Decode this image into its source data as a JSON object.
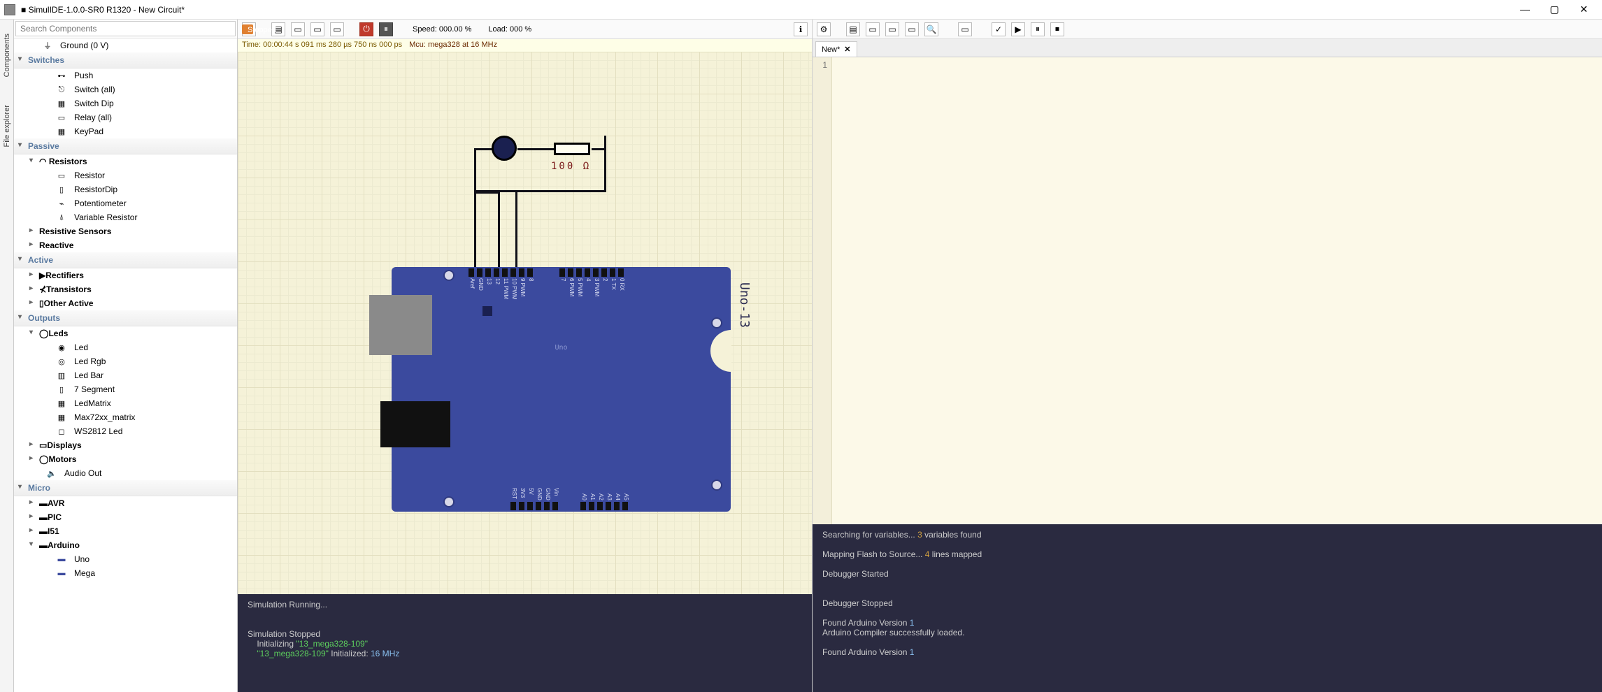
{
  "window": {
    "title": "■ SimulIDE-1.0.0-SR0 R1320 - New Circuit*",
    "min": "—",
    "max": "▢",
    "close": "✕"
  },
  "sidetabs": {
    "components": "Components",
    "file_explorer": "File explorer"
  },
  "search": {
    "placeholder": "Search Components"
  },
  "tree": {
    "ground": "Ground (0 V)",
    "cat_switches": "Switches",
    "sw_push": "Push",
    "sw_all": "Switch (all)",
    "sw_dip": "Switch Dip",
    "sw_relay": "Relay (all)",
    "sw_keypad": "KeyPad",
    "cat_passive": "Passive",
    "sub_resistors": "Resistors",
    "r_res": "Resistor",
    "r_dip": "ResistorDip",
    "r_pot": "Potentiometer",
    "r_var": "Variable Resistor",
    "sub_rsense": "Resistive Sensors",
    "sub_reactive": "Reactive",
    "cat_active": "Active",
    "sub_rect": "Rectifiers",
    "sub_trans": "Transistors",
    "sub_other_active": "Other Active",
    "cat_outputs": "Outputs",
    "sub_leds": "Leds",
    "l_led": "Led",
    "l_rgb": "Led Rgb",
    "l_bar": "Led Bar",
    "l_7seg": "7 Segment",
    "l_matrix": "LedMatrix",
    "l_max": "Max72xx_matrix",
    "l_ws": "WS2812 Led",
    "sub_displays": "Displays",
    "sub_motors": "Motors",
    "sub_audio": "Audio Out",
    "cat_micro": "Micro",
    "m_avr": "AVR",
    "m_pic": "PIC",
    "m_i51": "I51",
    "m_arduino": "Arduino",
    "m_uno": "Uno",
    "m_mega": "Mega"
  },
  "sim_toolbar": {
    "speed": "Speed: 000.00 %",
    "load": "Load: 000 %",
    "state": "Stopped"
  },
  "infobar": {
    "time": "Time: 00:00:44 s  091 ms  280 µs  750 ns  000 ps",
    "mcu": "Mcu: mega328 at 16 MHz"
  },
  "board": {
    "name": "Uno-13",
    "silk": "Uno",
    "pins_top_left": [
      "Aref",
      "GND",
      "13",
      "12",
      "11 PWM",
      "10 PWM",
      "9 PWM",
      "8"
    ],
    "pins_top_right": [
      "7",
      "6 PWM",
      "5 PWM",
      "4",
      "3 PWM",
      "2",
      "1 TX",
      "0 RX"
    ],
    "pins_bot_left": [
      "RST",
      "3V3",
      "5V",
      "GND",
      "GND",
      "Vin"
    ],
    "pins_bot_right": [
      "A0",
      "A1",
      "A2",
      "A3",
      "A4",
      "A5"
    ],
    "res_label": "100 Ω"
  },
  "console1": {
    "l1": "Simulation Running...",
    "l2": "Simulation Stopped",
    "l3": "    Initializing ",
    "l3b": "\"13_mega328-109\"",
    "l4": "    ",
    "l4b": "\"13_mega328-109\"",
    "l4c": " Initialized:",
    "l4d": " 16 MHz"
  },
  "editor": {
    "tab": "New*",
    "line1": "1"
  },
  "console2": {
    "l1a": "Searching for variables... ",
    "l1b": "3",
    "l1c": " variables found",
    "l2a": "Mapping Flash to Source... ",
    "l2b": "4",
    "l2c": " lines mapped",
    "l3": "Debugger Started",
    "l4": "Debugger Stopped",
    "l5a": "Found Arduino Version ",
    "l5b": "1",
    "l6": "Arduino Compiler successfully loaded.",
    "l7a": "Found Arduino Version ",
    "l7b": "1"
  }
}
